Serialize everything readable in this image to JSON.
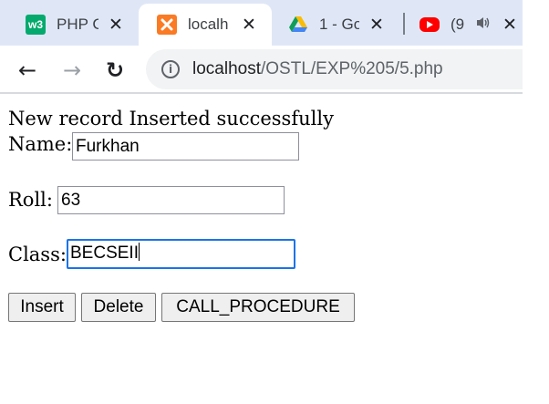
{
  "browser": {
    "tabs": [
      {
        "title": "PHP C",
        "icon": "w3schools-icon",
        "active": false
      },
      {
        "title": "localh",
        "icon": "xampp-icon",
        "active": true
      },
      {
        "title": "1 - Go",
        "icon": "google-drive-icon",
        "active": false
      },
      {
        "title": "(9",
        "icon": "youtube-icon",
        "active": false
      }
    ],
    "close_glyph": "✕",
    "back_glyph": "←",
    "forward_glyph": "→",
    "reload_glyph": "↻",
    "url_host": "localhost",
    "url_path": "/OSTL/EXP%205/5.php"
  },
  "page": {
    "message": "New record Inserted successfully",
    "form": {
      "name_label": "Name:",
      "name_value": "Furkhan",
      "roll_label": "Roll:",
      "roll_value": "63",
      "class_label": "Class:",
      "class_value": "BECSEII"
    },
    "buttons": {
      "insert": "Insert",
      "delete": "Delete",
      "call_procedure": "CALL_PROCEDURE"
    }
  },
  "colors": {
    "tabstrip": "#dfe7f7",
    "focus": "#1a73e8",
    "w3schools": "#04aa6d",
    "xampp": "#fb7a24",
    "youtube": "#ff0000"
  }
}
